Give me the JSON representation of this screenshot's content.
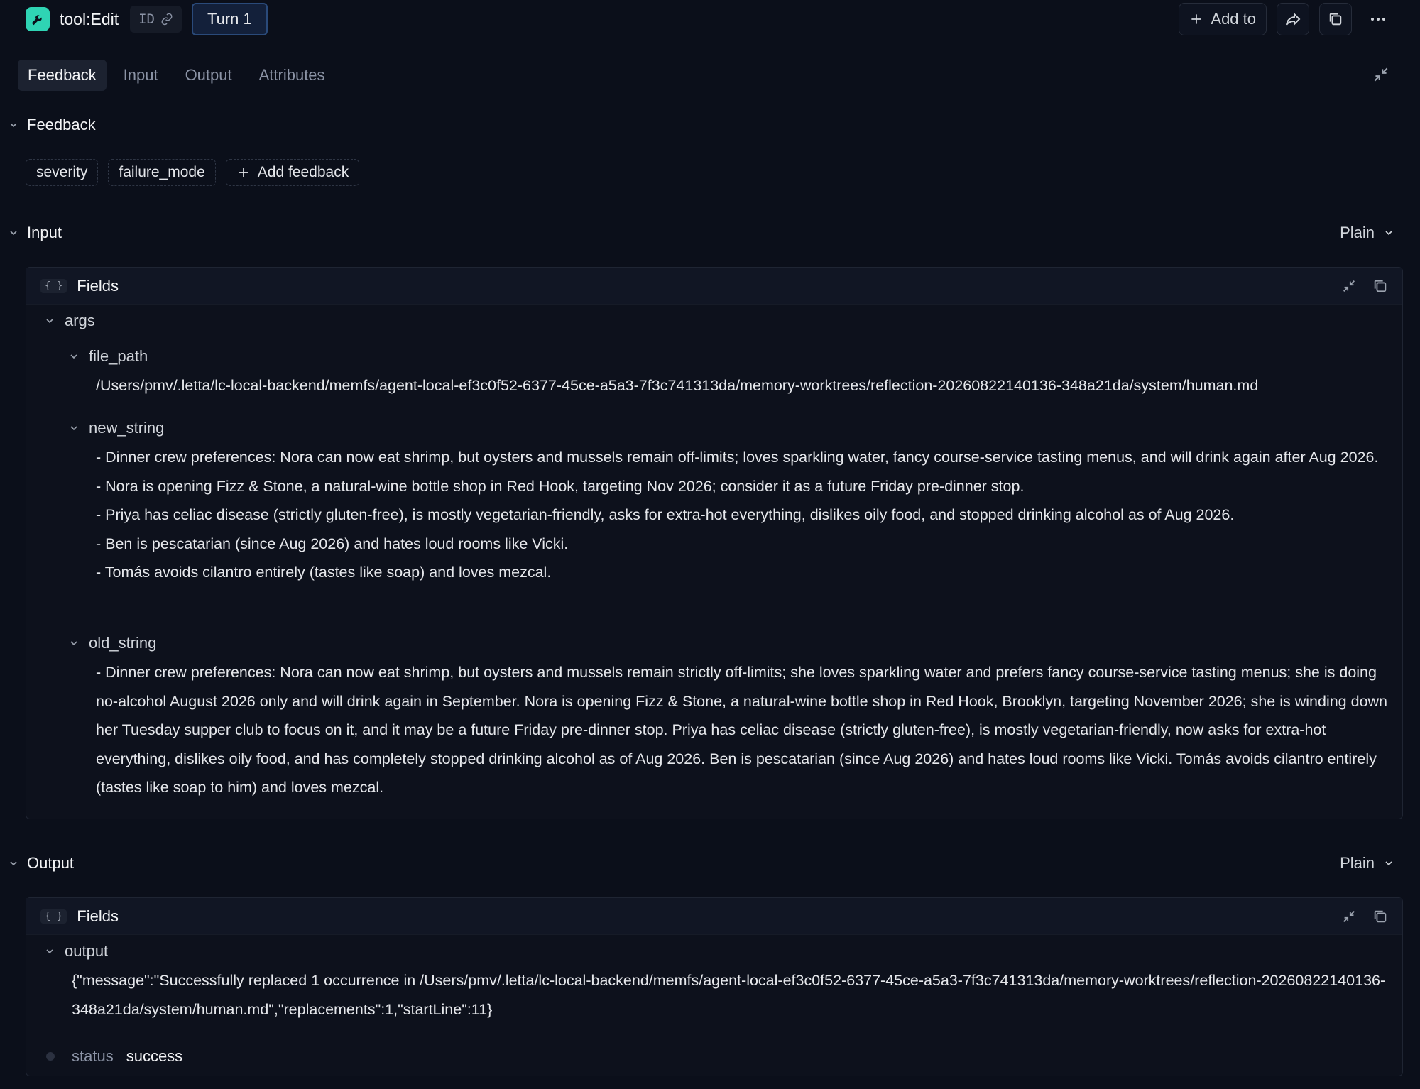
{
  "header": {
    "title": "tool:Edit",
    "id_label": "ID",
    "turn_label": "Turn 1",
    "add_to_label": "Add to"
  },
  "tabs": [
    {
      "label": "Feedback",
      "active": true
    },
    {
      "label": "Input",
      "active": false
    },
    {
      "label": "Output",
      "active": false
    },
    {
      "label": "Attributes",
      "active": false
    }
  ],
  "feedback": {
    "heading": "Feedback",
    "chips": [
      "severity",
      "failure_mode"
    ],
    "add_label": "Add feedback"
  },
  "input": {
    "heading": "Input",
    "format": "Plain",
    "panel_title": "Fields",
    "root_key": "args",
    "fields": [
      {
        "key": "file_path",
        "value": "/Users/pmv/.letta/lc-local-backend/memfs/agent-local-ef3c0f52-6377-45ce-a5a3-7f3c741313da/memory-worktrees/reflection-20260822140136-348a21da/system/human.md"
      },
      {
        "key": "new_string",
        "value": "- Dinner crew preferences: Nora can now eat shrimp, but oysters and mussels remain off-limits; loves sparkling water, fancy course-service tasting menus, and will drink again after Aug 2026.\n- Nora is opening Fizz & Stone, a natural-wine bottle shop in Red Hook, targeting Nov 2026; consider it as a future Friday pre-dinner stop.\n- Priya has celiac disease (strictly gluten-free), is mostly vegetarian-friendly, asks for extra-hot everything, dislikes oily food, and stopped drinking alcohol as of Aug 2026.\n- Ben is pescatarian (since Aug 2026) and hates loud rooms like Vicki.\n- Tomás avoids cilantro entirely (tastes like soap) and loves mezcal."
      },
      {
        "key": "old_string",
        "value": "- Dinner crew preferences: Nora can now eat shrimp, but oysters and mussels remain strictly off-limits; she loves sparkling water and prefers fancy course-service tasting menus; she is doing no-alcohol August 2026 only and will drink again in September. Nora is opening Fizz & Stone, a natural-wine bottle shop in Red Hook, Brooklyn, targeting November 2026; she is winding down her Tuesday supper club to focus on it, and it may be a future Friday pre-dinner stop. Priya has celiac disease (strictly gluten-free), is mostly vegetarian-friendly, now asks for extra-hot everything, dislikes oily food, and has completely stopped drinking alcohol as of Aug 2026. Ben is pescatarian (since Aug 2026) and hates loud rooms like Vicki. Tomás avoids cilantro entirely (tastes like soap to him) and loves mezcal."
      }
    ]
  },
  "output": {
    "heading": "Output",
    "format": "Plain",
    "panel_title": "Fields",
    "output_key": "output",
    "output_value": "{\"message\":\"Successfully replaced 1 occurrence in /Users/pmv/.letta/lc-local-backend/memfs/agent-local-ef3c0f52-6377-45ce-a5a3-7f3c741313da/memory-worktrees/reflection-20260822140136-348a21da/system/human.md\",\"replacements\":1,\"startLine\":11}",
    "status_key": "status",
    "status_value": "success"
  },
  "colors": {
    "background": "#0b0f1a",
    "logo": "#2fd4b4",
    "turn_border": "#2a4a7a"
  },
  "icons": [
    "wrench-icon",
    "link-icon",
    "plus-icon",
    "share-icon",
    "copy-icon",
    "more-icon",
    "collapse-icon",
    "chevron-down-icon",
    "braces-icon"
  ]
}
